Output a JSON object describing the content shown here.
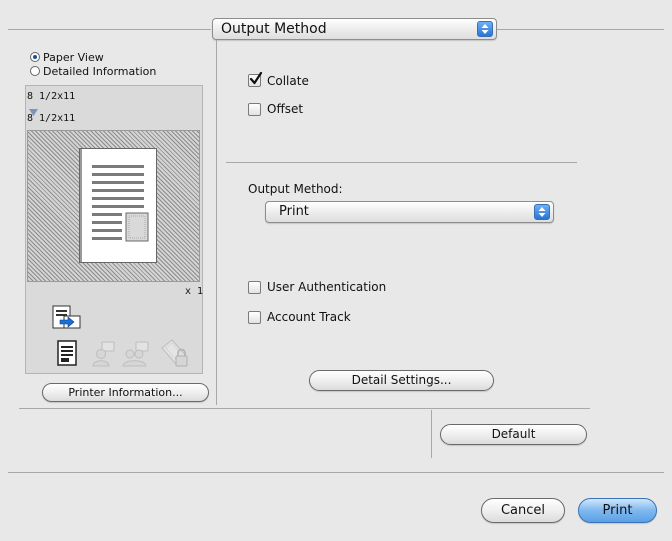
{
  "top_popup": {
    "label": "Output Method"
  },
  "view_options": [
    {
      "label": "Paper View",
      "selected": true
    },
    {
      "label": "Detailed Information",
      "selected": false
    }
  ],
  "preview": {
    "original_size": "8 1/2x11",
    "output_size": "8 1/2x11",
    "copies": "x 1"
  },
  "printer_info_button": "Printer Information...",
  "options": {
    "collate": {
      "label": "Collate",
      "checked": true
    },
    "offset": {
      "label": "Offset",
      "checked": false
    }
  },
  "output_method": {
    "label": "Output Method:",
    "value": "Print"
  },
  "auth": {
    "user_authentication": {
      "label": "User Authentication",
      "checked": false
    },
    "account_track": {
      "label": "Account Track",
      "checked": false
    }
  },
  "detail_settings_button": "Detail Settings...",
  "default_button": "Default",
  "footer": {
    "cancel_button": "Cancel",
    "print_button": "Print"
  },
  "colors": {
    "accent_blue": "#2a74d3",
    "background": "#e8e8e8"
  }
}
